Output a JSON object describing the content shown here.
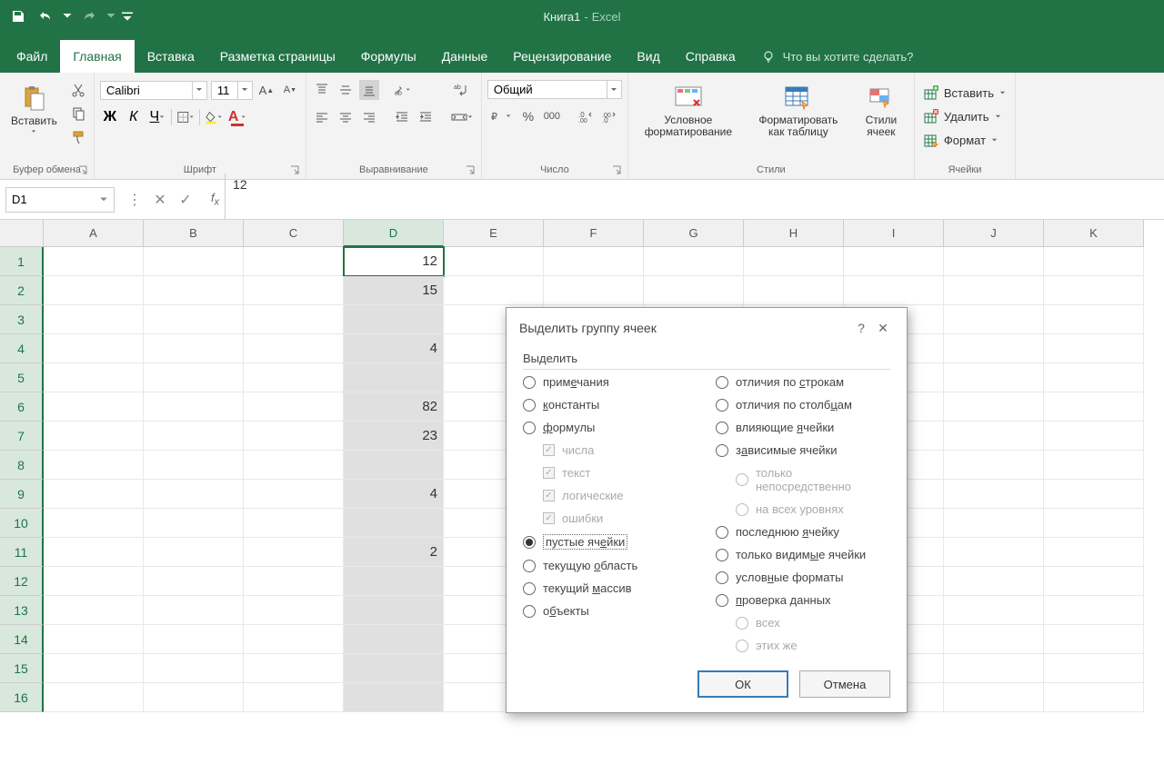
{
  "app": {
    "title_doc": "Книга1",
    "title_app": "Excel"
  },
  "tabs": {
    "file": "Файл",
    "home": "Главная",
    "insert": "Вставка",
    "layout": "Разметка страницы",
    "formulas": "Формулы",
    "data": "Данные",
    "review": "Рецензирование",
    "view": "Вид",
    "help": "Справка",
    "tellme": "Что вы хотите сделать?"
  },
  "ribbon": {
    "clipboard": {
      "paste": "Вставить",
      "label": "Буфер обмена"
    },
    "font": {
      "name": "Calibri",
      "size": "11",
      "label": "Шрифт",
      "bold": "Ж",
      "italic": "К",
      "underline": "Ч"
    },
    "alignment": {
      "label": "Выравнивание"
    },
    "number": {
      "format": "Общий",
      "label": "Число"
    },
    "styles": {
      "cond": "Условное форматирование",
      "table": "Форматировать как таблицу",
      "cell": "Стили ячеек",
      "label": "Стили"
    },
    "cells": {
      "insert": "Вставить",
      "delete": "Удалить",
      "format": "Формат",
      "label": "Ячейки"
    }
  },
  "formula": {
    "namebox": "D1",
    "value": "12"
  },
  "grid": {
    "cols": [
      "A",
      "B",
      "C",
      "D",
      "E",
      "F",
      "G",
      "H",
      "I",
      "J",
      "K"
    ],
    "rows": 16,
    "selected_col": 3,
    "data_col": 3,
    "data": {
      "1": "12",
      "2": "15",
      "4": "4",
      "6": "82",
      "7": "23",
      "9": "4",
      "11": "2"
    }
  },
  "dialog": {
    "title": "Выделить группу ячеек",
    "group": "Выделить",
    "help": "?",
    "left": [
      {
        "key": "notes",
        "label": "примечания",
        "u": 4
      },
      {
        "key": "constants",
        "label": "константы",
        "u": 0
      },
      {
        "key": "formulas",
        "label": "формулы",
        "u": 0
      },
      {
        "key": "blanks",
        "label": "пустые ячейки",
        "u": 9,
        "selected": true
      },
      {
        "key": "region",
        "label": "текущую область",
        "u": 8
      },
      {
        "key": "array",
        "label": "текущий массив",
        "u": 8
      },
      {
        "key": "objects",
        "label": "объекты",
        "u": 1
      }
    ],
    "formula_subs": [
      "числа",
      "текст",
      "логические",
      "ошибки"
    ],
    "right": [
      {
        "key": "rowdiff",
        "label": "отличия по строкам",
        "u": 11
      },
      {
        "key": "coldiff",
        "label": "отличия по столбцам",
        "u": 16
      },
      {
        "key": "prec",
        "label": "влияющие ячейки",
        "u": 9
      },
      {
        "key": "dep",
        "label": "зависимые ячейки",
        "u": 1
      },
      {
        "key": "lastcell",
        "label": "последнюю ячейку",
        "u": 10
      },
      {
        "key": "visible",
        "label": "только видимые ячейки",
        "u": 12
      },
      {
        "key": "condfmt",
        "label": "условные форматы",
        "u": 5
      },
      {
        "key": "validation",
        "label": "проверка данных",
        "u": 0
      }
    ],
    "dep_subs": [
      "только непосредственно",
      "на всех уровнях"
    ],
    "val_subs": [
      "всех",
      "этих же"
    ],
    "ok": "ОК",
    "cancel": "Отмена"
  }
}
